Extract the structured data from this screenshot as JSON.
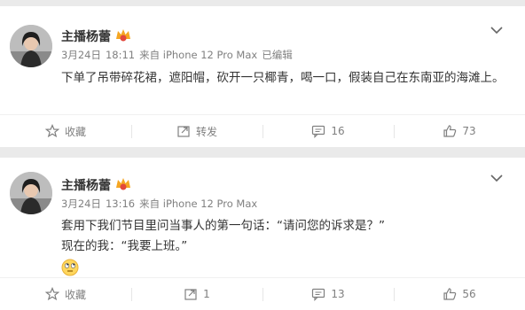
{
  "posts": [
    {
      "username": "主播杨蕾",
      "date": "3月24日",
      "time": "18:11",
      "source": "来自 iPhone 12 Pro Max",
      "edited": "已编辑",
      "text_lines": [
        "下单了吊带碎花裙，遮阳帽，砍开一只椰青，喝一口，假装自己在东南亚的海滩上。"
      ],
      "actions": {
        "favorite": "收藏",
        "repost": "转发",
        "comments": "16",
        "likes": "73"
      }
    },
    {
      "username": "主播杨蕾",
      "date": "3月24日",
      "time": "13:16",
      "source": "来自 iPhone 12 Pro Max",
      "text_lines": [
        "套用下我们节目里问当事人的第一句话：“请问您的诉求是？”",
        "现在的我：“我要上班。”"
      ],
      "emoji": "eye-roll-emoji",
      "actions": {
        "favorite": "收藏",
        "repost": "1",
        "comments": "13",
        "likes": "56"
      }
    }
  ],
  "colors": {
    "background": "#eaeaea",
    "card": "#ffffff",
    "meta": "#808080",
    "text": "#333333",
    "badge": "#f5a623"
  }
}
